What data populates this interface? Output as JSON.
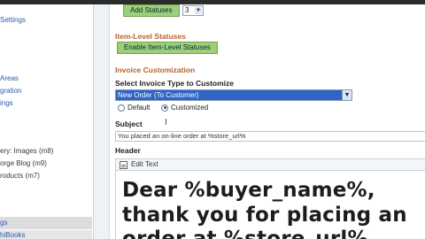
{
  "sidebar": {
    "items": [
      {
        "label": "Settings",
        "style": "link"
      },
      {
        "label": "Areas",
        "style": "link"
      },
      {
        "label": "gration",
        "style": "link"
      },
      {
        "label": "ings",
        "style": "link"
      },
      {
        "label": "ery: Images (m8)",
        "style": "plain"
      },
      {
        "label": "orge Blog (m9)",
        "style": "plain"
      },
      {
        "label": "roducts (m7)",
        "style": "plain"
      },
      {
        "label": "gs",
        "style": "active"
      },
      {
        "label": "hiBooks",
        "style": "active-2"
      }
    ]
  },
  "statuses": {
    "add_button": "Add Statuses",
    "count_value": "3"
  },
  "item_level": {
    "title": "Item-Level Statuses",
    "enable_button": "Enable Item-Level Statuses"
  },
  "invoice": {
    "title": "Invoice Customization",
    "select_label": "Select Invoice Type to Customize",
    "selected_type": "New Order (To Customer)",
    "radio_default": "Default",
    "radio_customized": "Customized",
    "subject_label": "Subject",
    "subject_value": "You placed an on-line order at %store_url%",
    "header_label": "Header",
    "edit_text_label": "Edit Text",
    "header_lines": [
      "Dear %buyer_name%,",
      "thank you for placing an",
      "order at %store_url%"
    ]
  },
  "icons": {
    "dropdown": "chevron-down-icon",
    "edit": "edit-text-icon",
    "cursor": "text-cursor-icon"
  },
  "colors": {
    "accent_orange": "#b8632b",
    "button_green": "#9bd07a",
    "link_blue": "#2a5db0",
    "selection_blue": "#3163c5"
  }
}
